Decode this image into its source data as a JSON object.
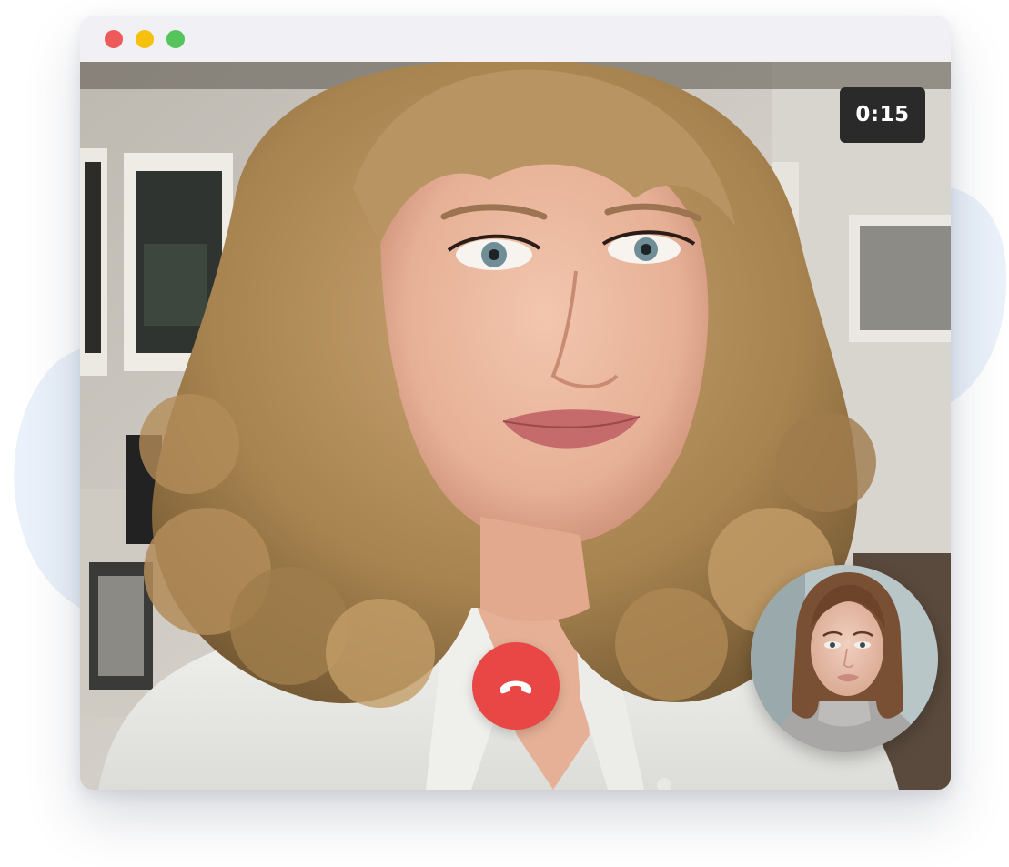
{
  "window": {
    "controls": [
      {
        "name": "close",
        "color": "#ee5a5a"
      },
      {
        "name": "minimize",
        "color": "#f5c10e"
      },
      {
        "name": "zoom",
        "color": "#55c45a"
      }
    ]
  },
  "call": {
    "timer": "0:15",
    "hangup_color": "#e94646",
    "remote_video_icon": "person-video",
    "self_view_icon": "person-video",
    "hangup_icon": "phone-hangup-icon"
  },
  "colors": {
    "window_bar": "#f0f0f5",
    "blob": "#eef3fa"
  }
}
